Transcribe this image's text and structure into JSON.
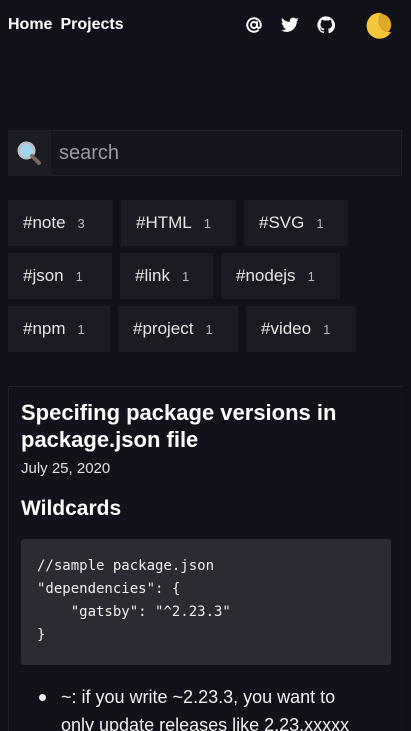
{
  "nav": {
    "home": "Home",
    "projects": "Projects"
  },
  "social": {
    "email_icon": "at-icon",
    "twitter_icon": "twitter-icon",
    "github_icon": "github-icon"
  },
  "theme": {
    "icon": "crescent-moon-icon",
    "accent": "#f6c53b"
  },
  "search": {
    "icon": "magnifier-icon",
    "placeholder": "search"
  },
  "tags": [
    [
      {
        "label": "#note",
        "count": "3"
      },
      {
        "label": "#HTML",
        "count": "1"
      },
      {
        "label": "#SVG",
        "count": "1"
      }
    ],
    [
      {
        "label": "#json",
        "count": "1"
      },
      {
        "label": "#link",
        "count": "1"
      },
      {
        "label": "#nodejs",
        "count": "1"
      }
    ],
    [
      {
        "label": "#npm",
        "count": "1"
      },
      {
        "label": "#project",
        "count": "1"
      },
      {
        "label": "#video",
        "count": "1"
      }
    ]
  ],
  "article": {
    "title": "Specifing package versions in package.json file",
    "date": "July 25, 2020",
    "section": "Wildcards",
    "code": "//sample package.json\n\"dependencies\": {\n    \"gatsby\": \"^2.23.3\"\n}",
    "bullet_1_line1": "~: if you write ~2.23.3, you want to",
    "bullet_1_line2": "only update releases like 2.23.xxxxx"
  }
}
